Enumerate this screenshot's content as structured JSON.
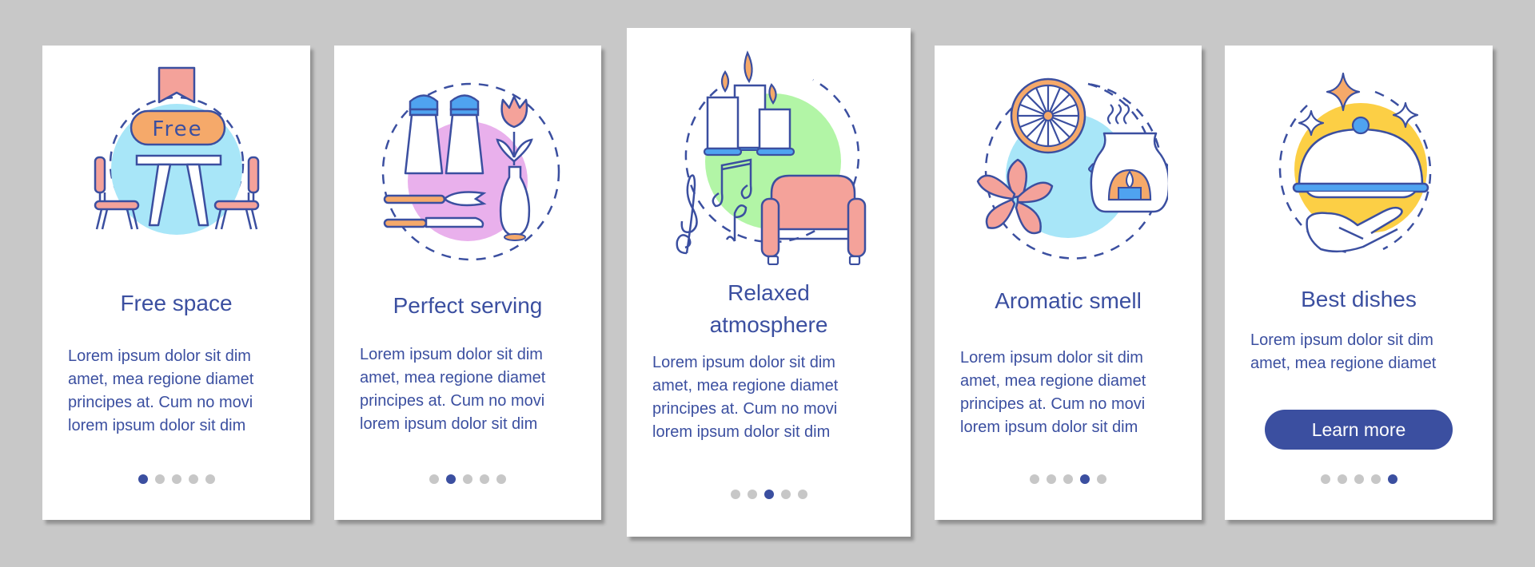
{
  "colors": {
    "background": "#c8c8c8",
    "card": "#ffffff",
    "primary": "#3b4fa0",
    "dot_inactive": "#c7c7c7",
    "accent_blue": "#a8e6f8",
    "accent_pink": "#e9b0ec",
    "accent_green": "#b2f5a6",
    "accent_yellow": "#fccf45",
    "salmon": "#f4a29a",
    "orange": "#f5a96a",
    "light_blue": "#4fa3f0"
  },
  "cards": [
    {
      "illustration": "table-with-chairs-free-sign",
      "sign_text": "Free",
      "title": "Free space",
      "body": "Lorem ipsum dolor sit dim\namet, mea regione diamet\nprincipes at. Cum no movi\nlorem ipsum dolor sit dim",
      "page_index": 1,
      "page_count": 5
    },
    {
      "illustration": "salt-pepper-cutlery-vase",
      "title": "Perfect serving",
      "body": "Lorem ipsum dolor sit dim\namet, mea regione diamet\nprincipes at. Cum no movi\nlorem ipsum dolor sit dim",
      "page_index": 2,
      "page_count": 5
    },
    {
      "illustration": "candles-music-armchair",
      "title": "Relaxed\natmosphere",
      "body": "Lorem ipsum dolor sit dim\namet, mea regione diamet\nprincipes at. Cum no movi\nlorem ipsum dolor sit dim",
      "page_index": 3,
      "page_count": 5
    },
    {
      "illustration": "citrus-flower-aroma-lamp",
      "title": "Aromatic smell",
      "body": "Lorem ipsum dolor sit dim\namet, mea regione diamet\nprincipes at. Cum no movi\nlorem ipsum dolor sit dim",
      "page_index": 4,
      "page_count": 5
    },
    {
      "illustration": "cloche-on-hand-sparkles",
      "title": "Best dishes",
      "body": "Lorem ipsum dolor sit dim\namet, mea regione diamet",
      "button_label": "Learn more",
      "page_index": 5,
      "page_count": 5
    }
  ]
}
